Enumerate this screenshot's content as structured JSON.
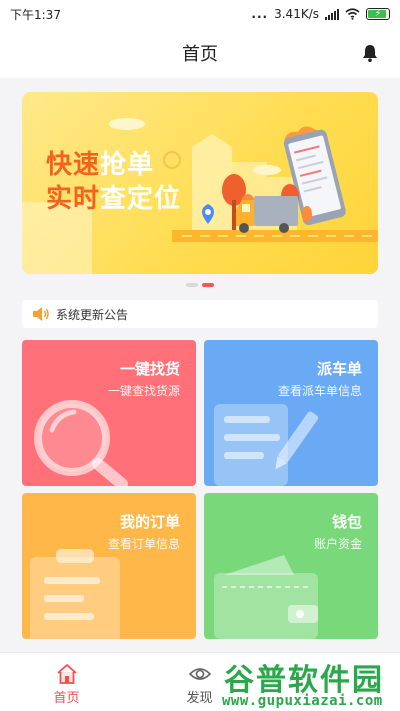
{
  "status_bar": {
    "time": "下午1:37",
    "dots": "...",
    "network_speed": "3.41K/s"
  },
  "header": {
    "title": "首页",
    "bell_icon": "bell-icon"
  },
  "banner": {
    "line1_orange": "快速",
    "line1_white": "抢单",
    "line2_orange": "实时",
    "line2_white": "查定位",
    "slide_count": 2,
    "active_slide": 2
  },
  "notice": {
    "icon": "speaker-icon",
    "text": "系统更新公告"
  },
  "cards": [
    {
      "title": "一键找货",
      "subtitle": "一键查找货源",
      "color": "#ff7078",
      "icon": "magnifier-icon"
    },
    {
      "title": "派车单",
      "subtitle": "查看派车单信息",
      "color": "#6aaaf4",
      "icon": "document-pen-icon"
    },
    {
      "title": "我的订单",
      "subtitle": "查看订单信息",
      "color": "#ffb74a",
      "icon": "clipboard-icon"
    },
    {
      "title": "钱包",
      "subtitle": "账户资金",
      "color": "#79d87a",
      "icon": "wallet-icon"
    }
  ],
  "bottom_nav": [
    {
      "label": "首页",
      "icon": "home-icon",
      "active": true
    },
    {
      "label": "发现",
      "icon": "eye-icon",
      "active": false
    }
  ],
  "watermark": {
    "main": "谷普软件园",
    "url": "www.gupuxiazai.com"
  },
  "colors": {
    "accent": "#ef4f4f",
    "banner_orange": "#f5611e"
  }
}
